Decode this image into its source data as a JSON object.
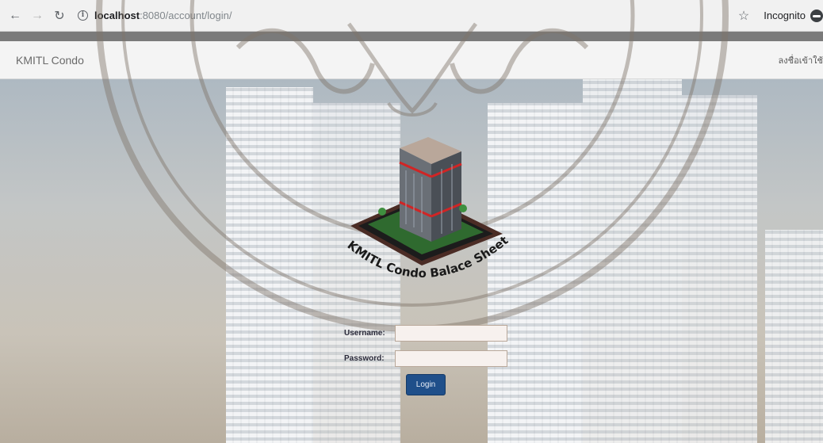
{
  "browser": {
    "url_host": "localhost",
    "url_path": ":8080/account/login/",
    "incognito_label": "Incognito"
  },
  "navbar": {
    "brand": "KMITL Condo",
    "right_link": "ลงชื่อเข้าใช้"
  },
  "logo": {
    "caption": "KMITL Condo Balace Sheet"
  },
  "login_form": {
    "username_label": "Username:",
    "password_label": "Password:",
    "username_value": "",
    "password_value": "",
    "login_button": "Login"
  },
  "icons": {
    "back": "back-arrow-icon",
    "forward": "forward-arrow-icon",
    "reload": "reload-icon",
    "info": "info-icon",
    "bookmark": "star-icon",
    "incognito": "incognito-icon"
  },
  "colors": {
    "login_button_bg": "#1f4f8a",
    "navbar_bg": "#f4f4f4"
  }
}
